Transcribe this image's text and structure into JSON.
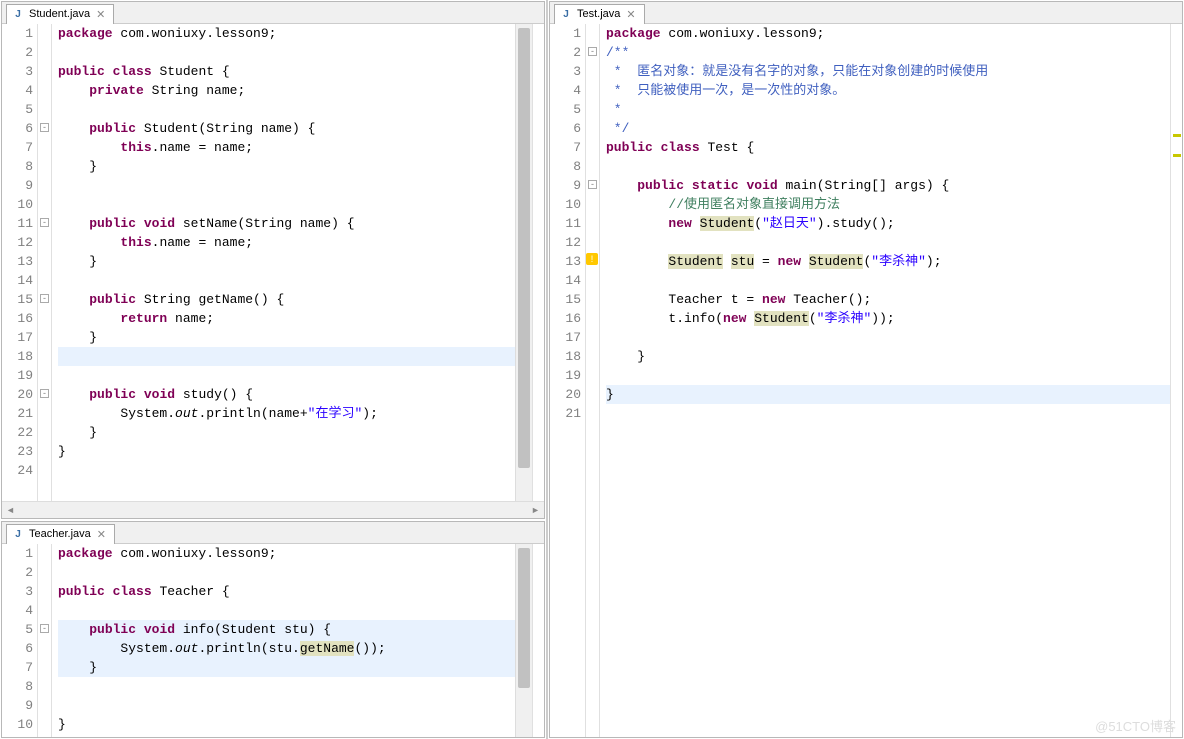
{
  "watermark": "@51CTO博客",
  "tabs": {
    "student": "Student.java",
    "teacher": "Teacher.java",
    "test": "Test.java"
  },
  "student": {
    "lines": [
      "1",
      "2",
      "3",
      "4",
      "5",
      "6",
      "7",
      "8",
      "9",
      "10",
      "11",
      "12",
      "13",
      "14",
      "15",
      "16",
      "17",
      "18",
      "19",
      "20",
      "21",
      "22",
      "23",
      "24"
    ],
    "t1a": "package",
    "t1b": " com.woniuxy.lesson9;",
    "t3a": "public",
    "t3b": " ",
    "t3c": "class",
    "t3d": " Student {",
    "t4a": "    ",
    "t4b": "private",
    "t4c": " String name;",
    "t6a": "    ",
    "t6b": "public",
    "t6c": " Student(String name) {",
    "t7a": "        ",
    "t7b": "this",
    "t7c": ".name = name;",
    "t8": "    }",
    "t11a": "    ",
    "t11b": "public",
    "t11c": " ",
    "t11d": "void",
    "t11e": " setName(String name) {",
    "t12a": "        ",
    "t12b": "this",
    "t12c": ".name = name;",
    "t13": "    }",
    "t15a": "    ",
    "t15b": "public",
    "t15c": " String getName() {",
    "t16a": "        ",
    "t16b": "return",
    "t16c": " name;",
    "t17": "    }",
    "t20a": "    ",
    "t20b": "public",
    "t20c": " ",
    "t20d": "void",
    "t20e": " study() {",
    "t21a": "        System.",
    "t21b": "out",
    "t21c": ".println(name+",
    "t21d": "\"在学习\"",
    "t21e": ");",
    "t22": "    }",
    "t23": "}"
  },
  "teacher": {
    "lines": [
      "1",
      "2",
      "3",
      "4",
      "5",
      "6",
      "7",
      "8",
      "9",
      "10"
    ],
    "t1a": "package",
    "t1b": " com.woniuxy.lesson9;",
    "t3a": "public",
    "t3b": " ",
    "t3c": "class",
    "t3d": " Teacher {",
    "t5a": "    ",
    "t5b": "public",
    "t5c": " ",
    "t5d": "void",
    "t5e": " info(Student stu) {",
    "t6a": "        System.",
    "t6b": "out",
    "t6c": ".println(stu.",
    "t6d": "getName",
    "t6e": "());",
    "t7": "    }",
    "t10": "}"
  },
  "test": {
    "lines": [
      "1",
      "2",
      "3",
      "4",
      "5",
      "6",
      "7",
      "8",
      "9",
      "10",
      "11",
      "12",
      "13",
      "14",
      "15",
      "16",
      "17",
      "18",
      "19",
      "20",
      "21"
    ],
    "t1a": "package",
    "t1b": " com.woniuxy.lesson9;",
    "t2": "/**",
    "t3": " *  匿名对象：就是没有名字的对象，只能在对象创建的时候使用",
    "t4": " *  只能被使用一次，是一次性的对象。",
    "t5": " *",
    "t6": " */",
    "t7a": "public",
    "t7b": " ",
    "t7c": "class",
    "t7d": " Test {",
    "t9a": "    ",
    "t9b": "public",
    "t9c": " ",
    "t9d": "static",
    "t9e": " ",
    "t9f": "void",
    "t9g": " main(String[] args) {",
    "t10": "        //使用匿名对象直接调用方法",
    "t11a": "        ",
    "t11b": "new",
    "t11c": " ",
    "t11d": "Student",
    "t11e": "(",
    "t11f": "\"赵日天\"",
    "t11g": ").study();",
    "t13a": "        ",
    "t13b": "Student",
    "t13c": " ",
    "t13d": "stu",
    "t13e": " = ",
    "t13f": "new",
    "t13g": " ",
    "t13h": "Student",
    "t13i": "(",
    "t13j": "\"李杀神\"",
    "t13k": ");",
    "t15a": "        Teacher t = ",
    "t15b": "new",
    "t15c": " Teacher();",
    "t16a": "        t.info(",
    "t16b": "new",
    "t16c": " ",
    "t16d": "Student",
    "t16e": "(",
    "t16f": "\"李杀神\"",
    "t16g": "));",
    "t18": "    }",
    "t20": "}"
  }
}
